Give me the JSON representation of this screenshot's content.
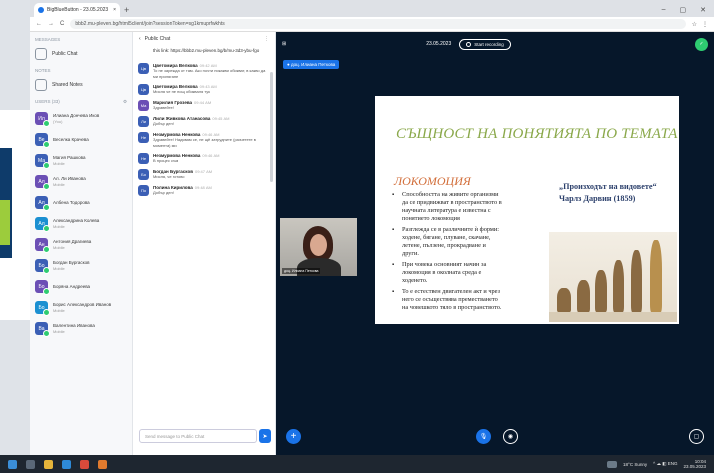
{
  "browser": {
    "tab_title": "BigBlueButton - 23.05.2023",
    "new_tab": "+",
    "window_controls": [
      "–",
      "▢",
      "✕"
    ],
    "url": "bbb2.mu-pleven.bg/html5client/join?sessionToken=sg1kmuprfwkhts",
    "nav": [
      "←",
      "→",
      "C"
    ],
    "ext_icons": [
      "☆",
      "⋮"
    ]
  },
  "sidebar": {
    "messages_label": "MESSAGES",
    "public_chat": "Public Chat",
    "notes_label": "NOTES",
    "shared_notes": "Shared Notes",
    "users_label": "USERS (33)",
    "users": [
      {
        "initials": "Ил",
        "name": "Илиана Дончева Иков",
        "role": "(You)",
        "color": "#6b4fb5"
      },
      {
        "initials": "Ве",
        "name": "Веселка Крачева",
        "role": "",
        "color": "#3b5fb5"
      },
      {
        "initials": "Ма",
        "name": "Магия Рашкова",
        "role": "Mobile",
        "color": "#3b5fb5"
      },
      {
        "initials": "Ал",
        "name": "Ал. Ли Иванова",
        "role": "Mobile",
        "color": "#6b4fb5"
      },
      {
        "initials": "Ал",
        "name": "Албена Тодорова",
        "role": "",
        "color": "#3b5fb5"
      },
      {
        "initials": "Ал",
        "name": "Александрина Колева",
        "role": "Mobile",
        "color": "#1a8fd1"
      },
      {
        "initials": "Ан",
        "name": "Антония Драгиева",
        "role": "Mobile",
        "color": "#6b4fb5"
      },
      {
        "initials": "Бо",
        "name": "Богдан Бургасков",
        "role": "Mobile",
        "color": "#3b5fb5"
      },
      {
        "initials": "Бо",
        "name": "Боряна Андреева",
        "role": "",
        "color": "#6b4fb5"
      },
      {
        "initials": "Бо",
        "name": "Борис Александров Иванов",
        "role": "Mobile",
        "color": "#1a8fd1"
      },
      {
        "initials": "Ва",
        "name": "Валентина Иванова",
        "role": "Mobile",
        "color": "#3b5fb5"
      }
    ]
  },
  "chat": {
    "back": "‹",
    "title": "Public Chat",
    "menu": "⋮",
    "welcome": "this link: https://bbb2.mu-pleven.bg/b/mu-3d3-ybu-fgo",
    "messages": [
      {
        "initials": "Цв",
        "name": "Цветомира Велкова",
        "time": "09:42 AM",
        "text": "То не зарежда от там. Ако почти никакви обикват, в какво да ми прилягане",
        "color": "#3b5fb5"
      },
      {
        "initials": "Цв",
        "name": "Цветомира Велкова",
        "time": "09:43 AM",
        "text": "Мисля че не пощ обикваля тук",
        "color": "#3b5fb5"
      },
      {
        "initials": "Ма",
        "name": "Марилия Грозева",
        "time": "09:44 AM",
        "text": "Здравейте!",
        "color": "#6b4fb5"
      },
      {
        "initials": "Ли",
        "name": "Лили Живкова Атанасова",
        "time": "09:45 AM",
        "text": "Добър ден!",
        "color": "#3b5fb5"
      },
      {
        "initials": "Не",
        "name": "Незмурмова Ненкова",
        "time": "09:46 AM",
        "text": "Здравейте! Надявам се, не щё затрудните (разчетете в момента) ми",
        "color": "#3b5fb5"
      },
      {
        "initials": "Не",
        "name": "Незмурмова Ненкова",
        "time": "09:46 AM",
        "text": "В процес съм",
        "color": "#3b5fb5"
      },
      {
        "initials": "Бо",
        "name": "Богдан Бургасков",
        "time": "09:47 AM",
        "text": "Мисля, че готово",
        "color": "#3b5fb5"
      },
      {
        "initials": "По",
        "name": "Полина Кирилова",
        "time": "09:48 AM",
        "text": "Добър ден!",
        "color": "#3b5fb5"
      }
    ],
    "input_placeholder": "Send message to Public Chat",
    "send": "➤"
  },
  "presentation": {
    "layout_icon": "⊞",
    "title": "23.05.2023",
    "record_label": "Start recording",
    "conn_icon": "✓",
    "talker": "● доц. Илиана Петкова",
    "webcam_label": "доц. Илиана Петкова",
    "slide": {
      "title": "СЪЩНОСТ НА ПОНЯТИЯТА ПО ТЕМАТА",
      "heading": "ЛОКОМОЦИЯ",
      "bullets": [
        "Способността на живите организми да се придвижват в пространството в научната литература е известна с понятието локомоция",
        "Разглежда се в различните ѝ форми: ходене, бягане, плуване, скачане, летене, пълзене, прокрадване и други.",
        "При човека основният начин за локомоция в околната среда е ходенето.",
        "То е естествен двигателен акт и чрез него се осъществява преместването на човешкото тяло в пространството."
      ],
      "right_line1": "„Произходът на видовете“",
      "right_line2": "Чарлз Дарвин (1859)"
    },
    "plus": "+",
    "mic": "🎙",
    "cam": "◉",
    "minimize": "▢"
  },
  "taskbar": {
    "weather": "18°C Sunny",
    "time": "10:04",
    "date": "23.05.2023",
    "tray_icons": "^ ☁ ◧ ENG"
  }
}
